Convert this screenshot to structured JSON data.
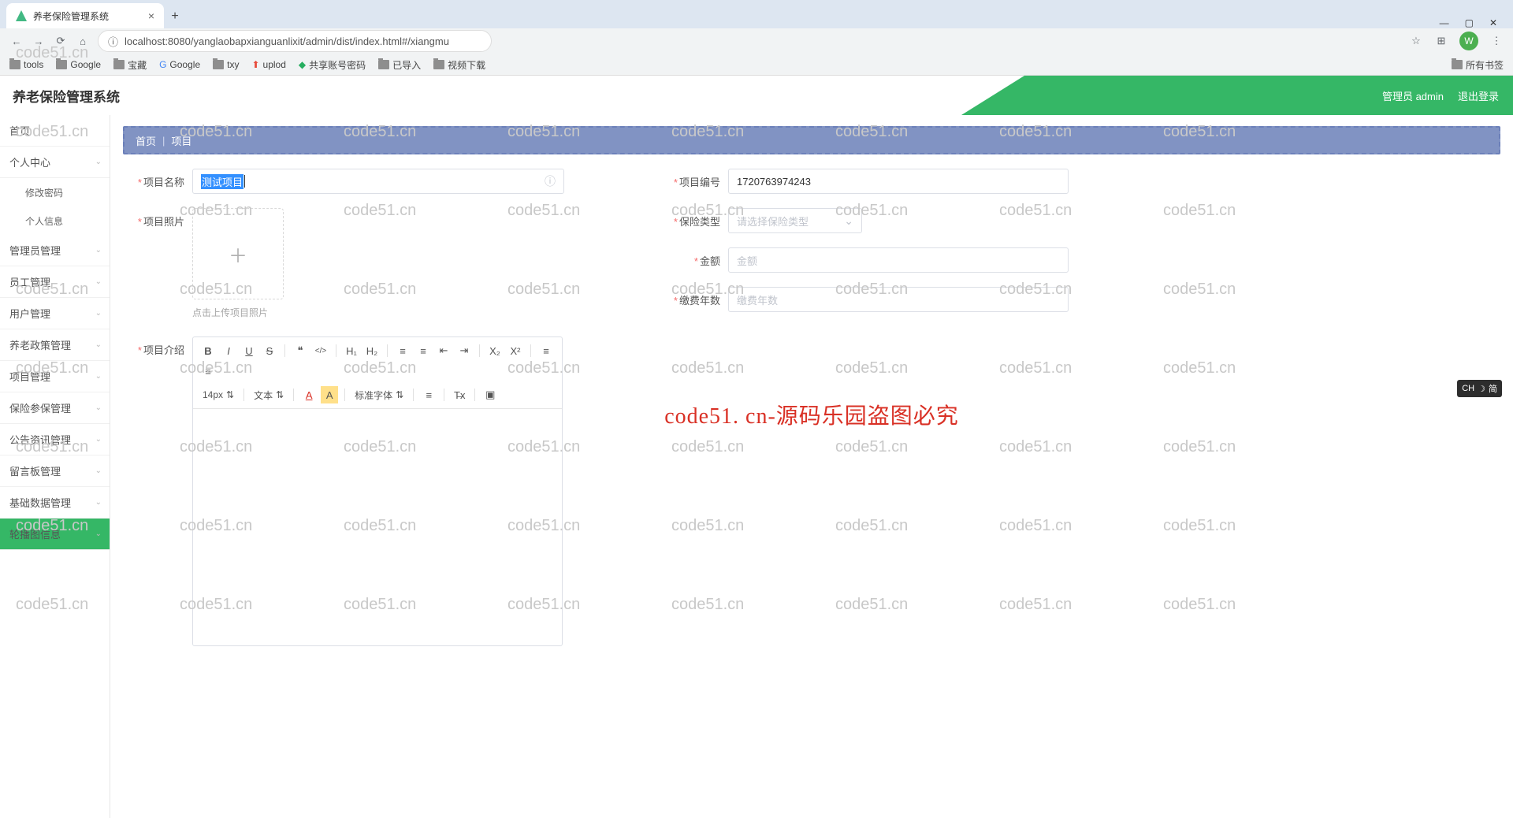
{
  "browser": {
    "tab_title": "养老保险管理系统",
    "new_tab": "+",
    "win_min": "—",
    "win_max": "▢",
    "win_close": "✕",
    "url": "localhost:8080/yanglaobapxianguanlixit/admin/dist/index.html#/xiangmu",
    "avatar": "W",
    "bookmarks": [
      "tools",
      "Google",
      "宝藏",
      "Google",
      "txy",
      "uplod",
      "共享账号密码",
      "已导入",
      "视频下载"
    ],
    "bookmarks_right": "所有书签"
  },
  "header": {
    "title": "养老保险管理系统",
    "user": "管理员 admin",
    "logout": "退出登录"
  },
  "sidebar": {
    "items": [
      {
        "label": "首页",
        "children": false
      },
      {
        "label": "个人中心",
        "children": true,
        "subs": [
          "修改密码",
          "个人信息"
        ]
      },
      {
        "label": "管理员管理",
        "children": true
      },
      {
        "label": "员工管理",
        "children": true
      },
      {
        "label": "用户管理",
        "children": true
      },
      {
        "label": "养老政策管理",
        "children": true
      },
      {
        "label": "项目管理",
        "children": true
      },
      {
        "label": "保险参保管理",
        "children": true
      },
      {
        "label": "公告资讯管理",
        "children": true
      },
      {
        "label": "留言板管理",
        "children": true
      },
      {
        "label": "基础数据管理",
        "children": true
      },
      {
        "label": "轮播图信息",
        "children": true,
        "active": true
      }
    ]
  },
  "breadcrumb": {
    "home": "首页",
    "sep": "|",
    "current": "项目"
  },
  "form": {
    "name_label": "项目名称",
    "name_value": "测试项目",
    "photo_label": "项目照片",
    "photo_hint": "点击上传项目照片",
    "intro_label": "项目介绍",
    "code_label": "项目编号",
    "code_value": "1720763974243",
    "type_label": "保险类型",
    "type_placeholder": "请选择保险类型",
    "amount_label": "金额",
    "amount_placeholder": "金额",
    "years_label": "缴费年数",
    "years_placeholder": "缴费年数"
  },
  "editor": {
    "font_size": "14px",
    "block": "文本",
    "font_family": "标准字体",
    "btns": {
      "bold": "B",
      "italic": "I",
      "underline": "U",
      "strike": "S",
      "quote": "❝",
      "code": "</>",
      "h1": "H₁",
      "h2": "H₂",
      "ol": "≡",
      "ul": "≡",
      "indent_dec": "⇤",
      "indent_inc": "⇥",
      "sub": "X₂",
      "sup": "X²",
      "align_l": "≡",
      "align_c": "≡",
      "a_color": "A",
      "a_bg": "A",
      "align": "≡",
      "clear": "T̶x",
      "image": "▣"
    }
  },
  "watermark": {
    "text": "code51.cn",
    "big": "code51. cn-源码乐园盗图必究"
  },
  "ime": {
    "lang": "CH",
    "mode": "简"
  }
}
